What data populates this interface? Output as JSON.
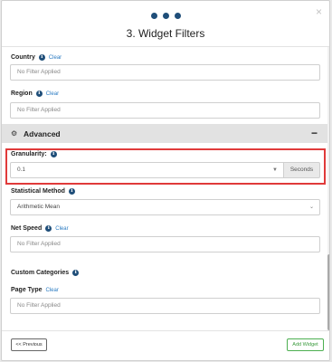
{
  "header": {
    "title": "3. Widget Filters",
    "step_dots": 3,
    "close_symbol": "×"
  },
  "filters": {
    "country": {
      "label": "Country",
      "clear": "Clear",
      "placeholder": "No Filter Applied"
    },
    "region": {
      "label": "Region",
      "clear": "Clear",
      "placeholder": "No Filter Applied"
    }
  },
  "advanced": {
    "title": "Advanced",
    "collapse_symbol": "−",
    "granularity": {
      "label": "Granularity:",
      "value": "0.1",
      "unit": "Seconds"
    },
    "statistical_method": {
      "label": "Statistical Method",
      "value": "Arithmetic Mean"
    },
    "net_speed": {
      "label": "Net Speed",
      "clear": "Clear",
      "placeholder": "No Filter Applied"
    },
    "custom_categories": {
      "label": "Custom Categories",
      "page_type": {
        "label": "Page Type",
        "clear": "Clear",
        "placeholder": "No Filter Applied"
      }
    }
  },
  "footer": {
    "previous_label": "<< Previous",
    "add_label": "Add Widget"
  },
  "colors": {
    "accent": "#1f4e79",
    "link": "#2a7bc2",
    "highlight": "#e03a3a",
    "success": "#4caf50"
  }
}
